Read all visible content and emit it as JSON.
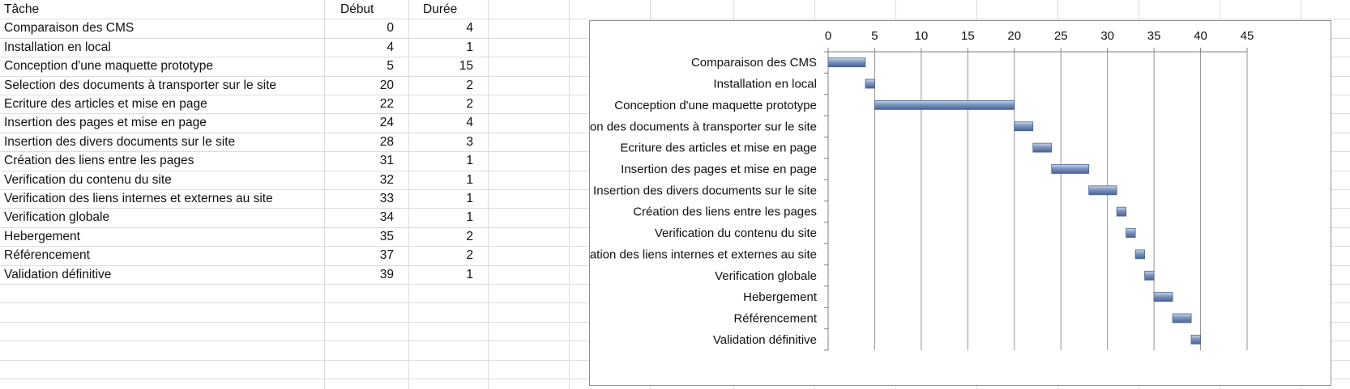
{
  "sheet": {
    "headers": {
      "task": "Tâche",
      "start": "Début",
      "duration": "Durée"
    },
    "rows": [
      {
        "task": "Comparaison des CMS",
        "start": "0",
        "duration": "4"
      },
      {
        "task": "Installation en local",
        "start": "4",
        "duration": "1"
      },
      {
        "task": "Conception d'une maquette prototype",
        "start": "5",
        "duration": "15"
      },
      {
        "task": "Selection des documents à transporter sur le site",
        "start": "20",
        "duration": "2"
      },
      {
        "task": "Ecriture des articles et mise en page",
        "start": "22",
        "duration": "2"
      },
      {
        "task": "Insertion des pages et mise en page",
        "start": "24",
        "duration": "4"
      },
      {
        "task": "Insertion des divers documents sur le site",
        "start": "28",
        "duration": "3"
      },
      {
        "task": "Création des liens entre les pages",
        "start": "31",
        "duration": "1"
      },
      {
        "task": "Verification du contenu du site",
        "start": "32",
        "duration": "1"
      },
      {
        "task": "Verification des liens internes et externes au site",
        "start": "33",
        "duration": "1"
      },
      {
        "task": "Verification globale",
        "start": "34",
        "duration": "1"
      },
      {
        "task": "Hebergement",
        "start": "35",
        "duration": "2"
      },
      {
        "task": "Référencement",
        "start": "37",
        "duration": "2"
      },
      {
        "task": "Validation définitive",
        "start": "39",
        "duration": "1"
      }
    ]
  },
  "chart_data": {
    "type": "bar",
    "orientation": "horizontal-stacked-gantt",
    "categories": [
      "Comparaison des CMS",
      "Installation en local",
      "Conception d'une maquette prototype",
      "Selection des documents à transporter sur le site",
      "Ecriture des articles et mise en page",
      "Insertion des pages et mise en page",
      "Insertion des divers documents sur le site",
      "Création des liens entre les pages",
      "Verification du contenu du site",
      "Verification des liens internes et externes au site",
      "Verification globale",
      "Hebergement",
      "Référencement",
      "Validation définitive"
    ],
    "series": [
      {
        "values": [
          0,
          4,
          5,
          20,
          22,
          24,
          28,
          31,
          32,
          33,
          34,
          35,
          37,
          39
        ],
        "visible": false
      },
      {
        "values": [
          4,
          1,
          15,
          2,
          2,
          4,
          3,
          1,
          1,
          1,
          1,
          2,
          2,
          1
        ],
        "color": "#7c94bd"
      }
    ],
    "xlim": [
      0,
      45
    ],
    "xticks": [
      "0",
      "5",
      "10",
      "15",
      "20",
      "25",
      "30",
      "35",
      "40",
      "45"
    ],
    "x_axis_position": "top",
    "grid": true,
    "legend": "none",
    "title": "",
    "xlabel": "",
    "ylabel": ""
  },
  "colors": {
    "bar_fill": "#7c94bd",
    "bar_top": "#c9d6ea",
    "bar_edge": "#4a6491",
    "grid": "#d9dde3",
    "axis": "#7f7f7f"
  }
}
